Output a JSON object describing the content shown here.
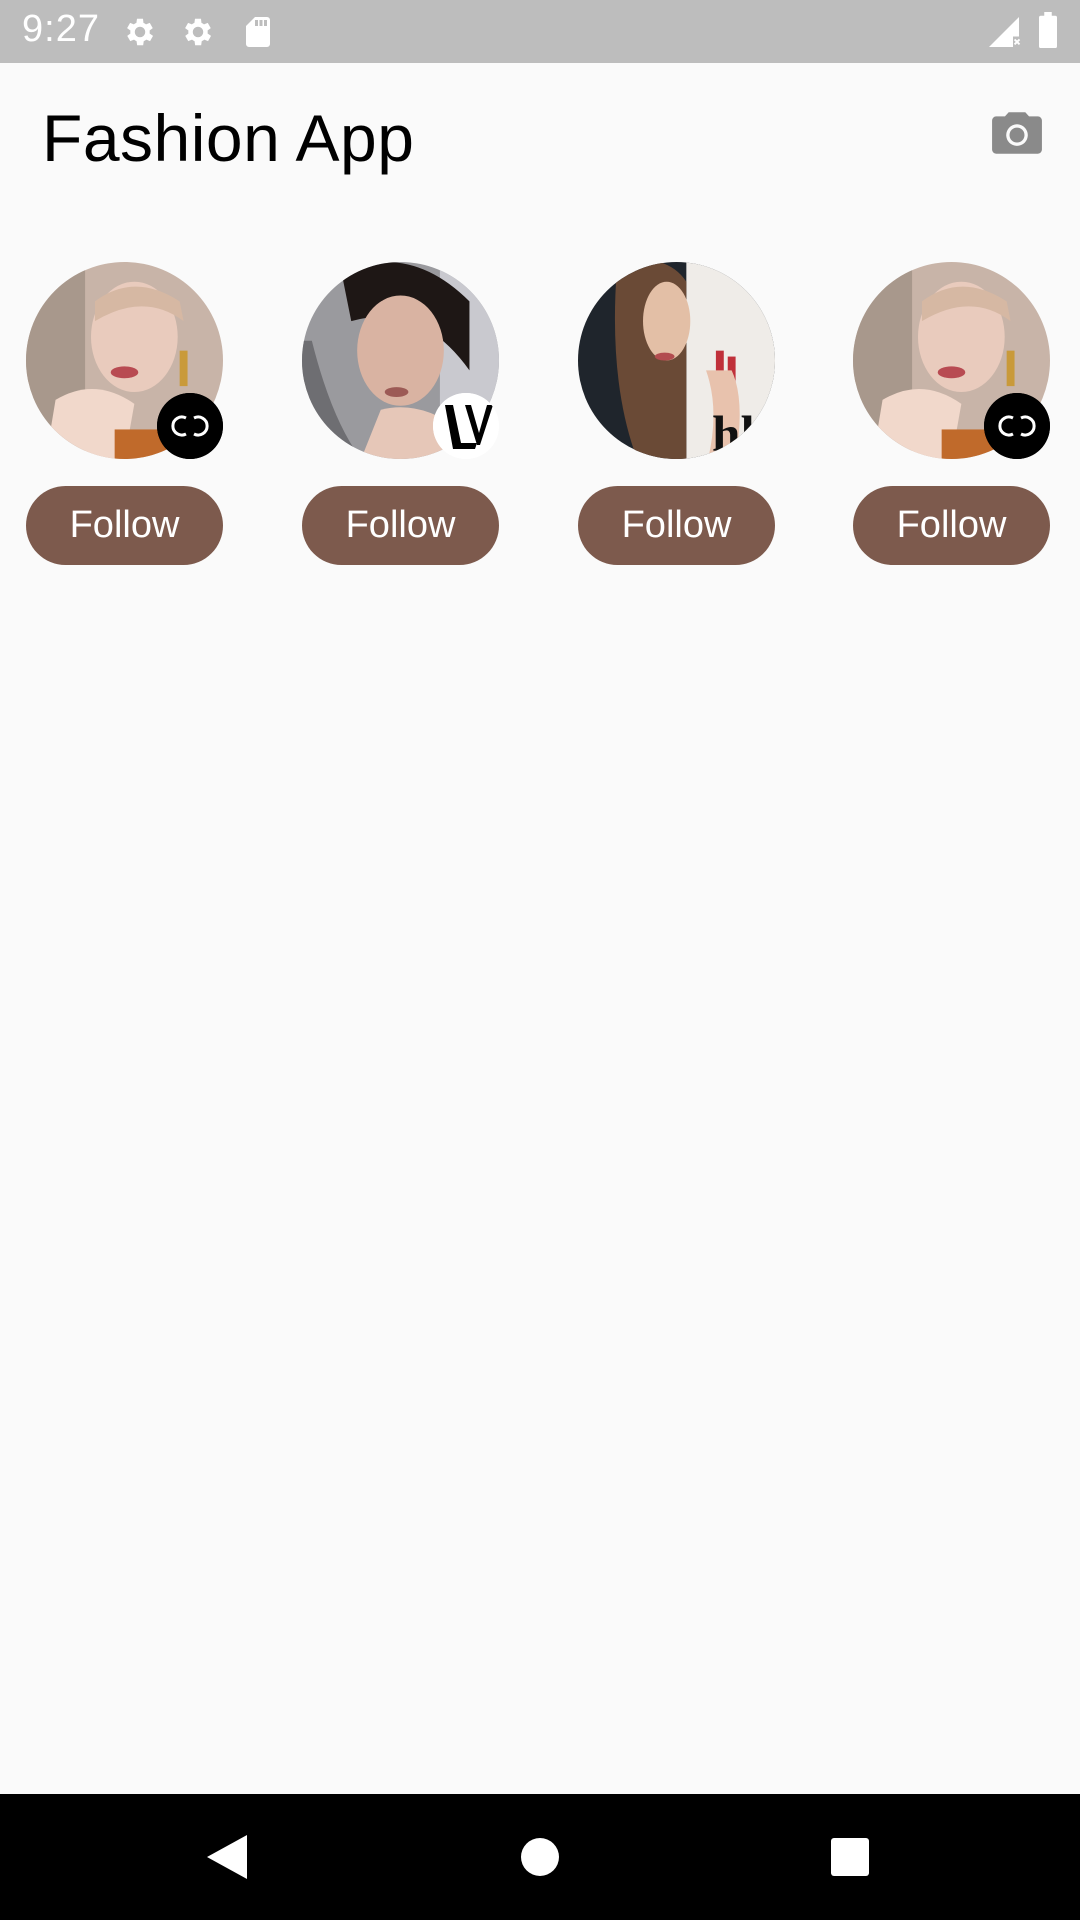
{
  "status_bar": {
    "time": "9:27",
    "icons": [
      "gear-icon",
      "gear-icon",
      "sd-card-icon",
      "signal-no-data-icon",
      "battery-icon"
    ]
  },
  "header": {
    "title": "Fashion App",
    "camera_icon": "camera-icon"
  },
  "cards": [
    {
      "follow_label": "Follow",
      "badge": "chanel-logo"
    },
    {
      "follow_label": "Follow",
      "badge": "lv-logo"
    },
    {
      "follow_label": "Follow",
      "badge": "chloe-logo"
    },
    {
      "follow_label": "Follow",
      "badge": "chanel-logo"
    }
  ],
  "nav_bar": {
    "icons": [
      "back-icon",
      "home-icon",
      "recents-icon"
    ]
  },
  "colors": {
    "accent": "#7d5a4d",
    "background": "#fafafa",
    "status_bar": "#bdbdbd",
    "nav_bar": "#000000"
  }
}
